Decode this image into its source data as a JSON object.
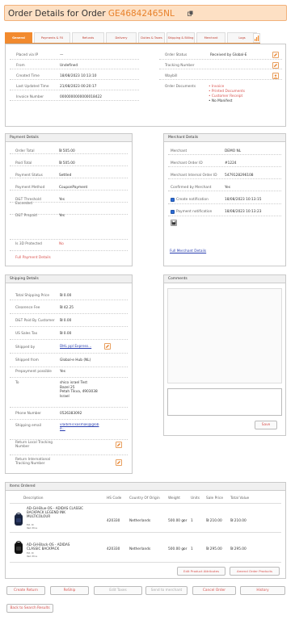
{
  "header": {
    "title": "Order Details for Order",
    "order_id": "GE46842465NL"
  },
  "tabs": [
    "General",
    "Payments & FX",
    "Refunds",
    "Delivery",
    "Duties & Taxes",
    "Shipping & Billing",
    "Merchant",
    "Logs"
  ],
  "general": {
    "left": [
      {
        "label": "Placed via IP",
        "value": "—"
      },
      {
        "label": "From",
        "value": "Undefined"
      },
      {
        "label": "Created Time",
        "value": "18/08/2023 10:13:10"
      },
      {
        "label": "Last Updated Time",
        "value": "21/08/2023 00:20:17"
      },
      {
        "label": "Invoice Number",
        "value": "0000000000000018422"
      }
    ],
    "right": [
      {
        "label": "Order Status",
        "value": "Received by Global-E"
      },
      {
        "label": "Tracking Number",
        "value": ""
      },
      {
        "label": "Waybill",
        "value": ""
      }
    ],
    "documents_label": "Order Documents",
    "documents": [
      "Invoice",
      "Printed Documents",
      "Customer Receipt",
      "No Manifest"
    ]
  },
  "payment": {
    "title": "Payment Details",
    "rows": [
      {
        "label": "Order Total",
        "value": "₪ 505.00"
      },
      {
        "label": "Paid Total",
        "value": "₪ 505.00"
      },
      {
        "label": "Payment Status",
        "value": "Settled"
      },
      {
        "label": "Payment Method",
        "value": "CouponPayment"
      },
      {
        "label": "D&T Threshold Exceeded",
        "value": "Yes"
      },
      {
        "label": "D&T Prepaid",
        "value": "Yes"
      },
      {
        "label": "Is 3D Protected",
        "value": "No"
      }
    ],
    "full_link": "Full Payment Details"
  },
  "merchant": {
    "title": "Merchant Details",
    "rows": [
      {
        "label": "Merchant",
        "value": "DEMO NL"
      },
      {
        "label": "Merchant Order ID",
        "value": "#1224"
      },
      {
        "label": "Merchant Internal Order ID",
        "value": "5479128296108"
      },
      {
        "label": "Confirmed by Merchant",
        "value": "Yes"
      },
      {
        "label": "Create notification",
        "value": "18/08/2023 10:13:15"
      },
      {
        "label": "Payment notification",
        "value": "18/08/2023 10:13:23"
      }
    ],
    "full_link": "Full Merchant Details"
  },
  "shipping": {
    "title": "Shipping Details",
    "rows": [
      {
        "label": "Total Shipping Price",
        "value": "₪ 0.00"
      },
      {
        "label": "Clearence Fee",
        "value": "₪ 42.25"
      },
      {
        "label": "D&T Paid By Customer",
        "value": "₪ 0.00"
      },
      {
        "label": "US Sales Tax",
        "value": "₪ 0.00"
      },
      {
        "label": "Shipped by",
        "value": "DHL ppl Express..."
      },
      {
        "label": "Shipped from",
        "value": "Global-e Hub (NL)"
      },
      {
        "label": "Prepayment possible",
        "value": "Yes"
      },
      {
        "label": "To",
        "value": "shico israel Test\nBazel 25\nPetah Tikva, 4903038\nIsrael"
      },
      {
        "label": "Phone Number",
        "value": "0526383092"
      },
      {
        "label": "Shipping email",
        "value": "vladimir.kosmak@globe..."
      },
      {
        "label": "Return Local Tracking Number",
        "value": ""
      },
      {
        "label": "Return International Tracking Number",
        "value": ""
      }
    ]
  },
  "comments": {
    "title": "Comments",
    "save_label": "Save"
  },
  "items": {
    "title": "Items Ordered",
    "columns": [
      "Description",
      "HS Code",
      "Country Of Origin",
      "Weight",
      "Units",
      "Sale Price",
      "Total Value"
    ],
    "rows": [
      {
        "desc": "AD-GH-Blue-OS - ADIDAS CLASSIC BACKPACK LEGEND INK MULTICOLOUR",
        "sub": "Ext. ID\nItem Price",
        "hs": "420330",
        "country": "Netherlands",
        "weight": "500.00 gr",
        "units": "1",
        "price": "₪ 210.00",
        "total": "₪ 210.00"
      },
      {
        "desc": "AD-GH-Black-OS - ADIDAS CLASSIC BACKPACK",
        "sub": "Ext. ID\nItem Price",
        "hs": "420330",
        "country": "Netherlands",
        "weight": "500.00 gr",
        "units": "1",
        "price": "₪ 295.00",
        "total": "₪ 295.00"
      }
    ],
    "edit_btn": "Edit Product Attributes",
    "amend_btn": "Amend Order Products"
  },
  "actions": [
    "Create Return",
    "ReShip",
    "Edit Taxes",
    "Send to merchant",
    "Cancel Order",
    "History"
  ],
  "back_label": "Back to Search Results",
  "colors": {
    "accent": "#f28a2e",
    "link": "#2a3fb0",
    "red": "#d9534f"
  }
}
